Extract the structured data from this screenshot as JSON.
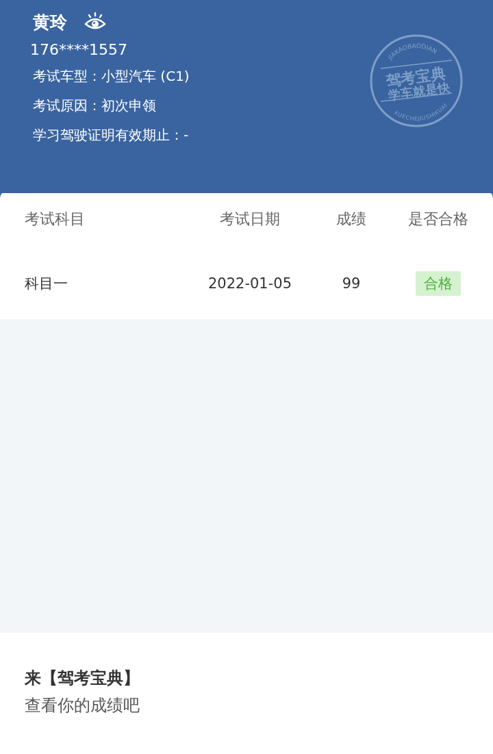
{
  "profile": {
    "name": "黄玲",
    "phone": "176****1557",
    "fields": [
      {
        "label": "考试车型：",
        "value": "小型汽车 (C1)"
      },
      {
        "label": "考试原因：",
        "value": "初次申领"
      },
      {
        "label": "学习驾驶证明有效期止：",
        "value": "-"
      }
    ]
  },
  "stamp": {
    "top_arc": "JIAKAOBAODIAN",
    "line_1": "驾考宝典",
    "line_2": "学车就是快",
    "bottom_arc": "XUECHEJIUSHIKUAI"
  },
  "table": {
    "columns": [
      "考试科目",
      "考试日期",
      "成绩",
      "是否合格"
    ],
    "rows": [
      {
        "subject": "科目一",
        "date": "2022-01-05",
        "score": "99",
        "result": "合格",
        "passed": true
      }
    ]
  },
  "footer": {
    "line_1": "来【驾考宝典】",
    "line_2": "查看你的成绩吧"
  }
}
